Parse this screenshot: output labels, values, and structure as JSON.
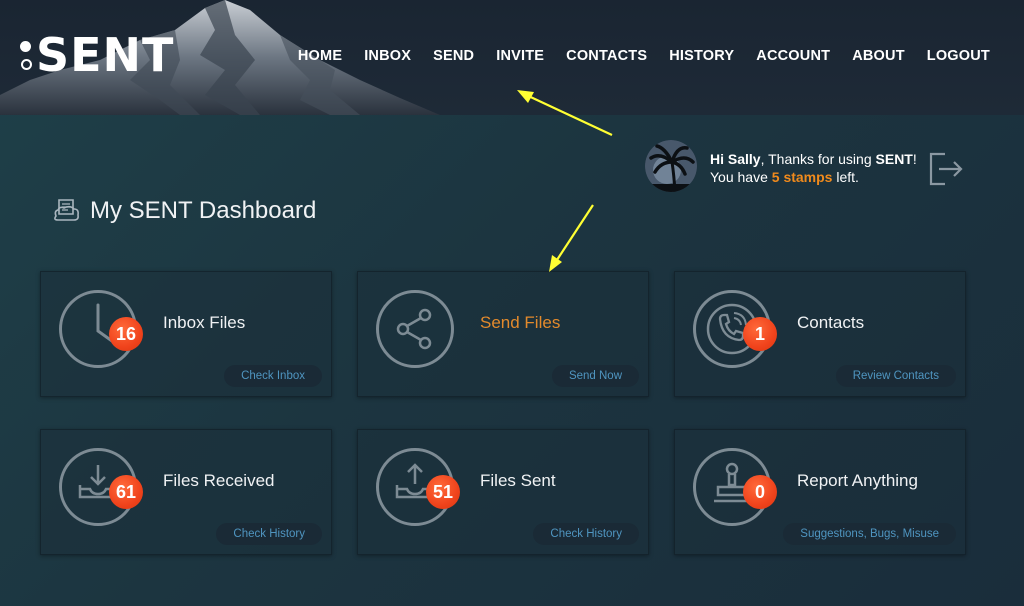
{
  "header": {
    "logo_text": "SENT",
    "nav": [
      "HOME",
      "INBOX",
      "SEND",
      "INVITE",
      "CONTACTS",
      "HISTORY",
      "ACCOUNT",
      "ABOUT",
      "LOGOUT"
    ]
  },
  "greeting": {
    "hi": "Hi Sally",
    "thanks_prefix": ", Thanks for using ",
    "brand": "SENT",
    "thanks_suffix": "!",
    "line2_prefix": "You have ",
    "stamps": "5 stamps",
    "line2_suffix": " left."
  },
  "dashboard": {
    "title": "My SENT Dashboard",
    "cards": [
      {
        "title": "Inbox Files",
        "badge": "16",
        "button": "Check Inbox",
        "icon": "clock-icon"
      },
      {
        "title": "Send Files",
        "badge": "",
        "button": "Send Now",
        "icon": "share-icon"
      },
      {
        "title": "Contacts",
        "badge": "1",
        "button": "Review Contacts",
        "icon": "phone-icon"
      },
      {
        "title": "Files Received",
        "badge": "61",
        "button": "Check History",
        "icon": "download-tray-icon"
      },
      {
        "title": "Files Sent",
        "badge": "51",
        "button": "Check History",
        "icon": "upload-tray-icon"
      },
      {
        "title": "Report Anything",
        "badge": "0",
        "button": "Suggestions, Bugs, Misuse",
        "icon": "stamp-icon"
      }
    ]
  },
  "colors": {
    "accent_orange": "#f08a1c",
    "badge_red": "#f0431c",
    "button_text_blue": "#4f95c0",
    "arrow_yellow": "#ffff33"
  }
}
